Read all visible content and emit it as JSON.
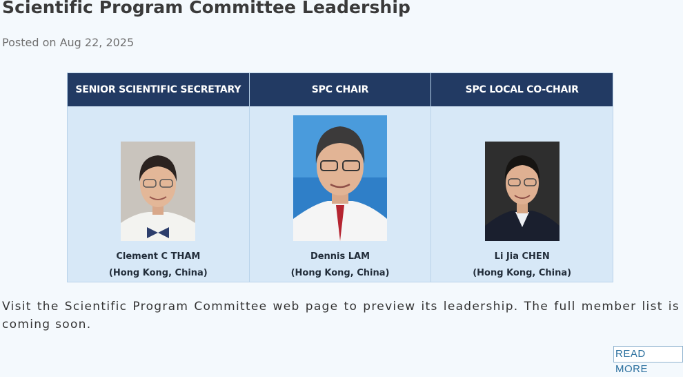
{
  "post": {
    "title": "Scientific Program Committee Leadership",
    "date": "Posted on Aug 22, 2025",
    "body": "Visit the Scientific Program Committee web page to preview its leadership. The full member list is coming soon.",
    "read_more": "READ MORE"
  },
  "panel": {
    "columns": [
      {
        "heading": "SENIOR SCIENTIFIC SECRETARY",
        "name": "Clement C THAM",
        "location": "(Hong Kong, China)"
      },
      {
        "heading": "SPC CHAIR",
        "name": "Dennis LAM",
        "location": "(Hong Kong, China)"
      },
      {
        "heading": "SPC LOCAL CO-CHAIR",
        "name": "Li Jia CHEN",
        "location": "(Hong Kong, China)"
      }
    ]
  },
  "colors": {
    "header_bg": "#223a63",
    "panel_bg": "#d7e8f7",
    "link": "#2a6f9e"
  }
}
